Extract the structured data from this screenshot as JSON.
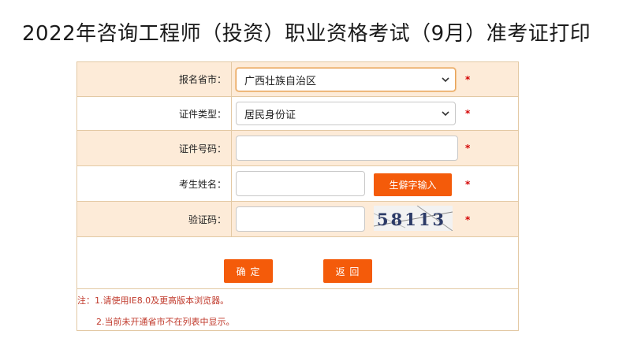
{
  "page": {
    "title": "2022年咨询工程师（投资）职业资格考试（9月）准考证打印"
  },
  "form": {
    "fields": {
      "province": {
        "label": "报名省市：",
        "value": "广西壮族自治区"
      },
      "id_type": {
        "label": "证件类型：",
        "value": "居民身份证"
      },
      "id_number": {
        "label": "证件号码：",
        "value": ""
      },
      "name": {
        "label": "考生姓名：",
        "value": "",
        "rare_char_button": "生僻字输入"
      },
      "captcha": {
        "label": "验证码：",
        "value": "",
        "image_text": "58113"
      }
    },
    "required_mark": "*",
    "buttons": {
      "confirm": "确 定",
      "back": "返 回"
    }
  },
  "notes": {
    "line1": "注：1.请使用IE8.0及更高版本浏览器。",
    "line2": "2.当前未开通省市不在列表中显示。"
  },
  "colors": {
    "accent": "#f45b0a",
    "row_alt": "#fdebd8",
    "border": "#e3c9a4",
    "note_text": "#c0392b",
    "required": "#d40000"
  }
}
